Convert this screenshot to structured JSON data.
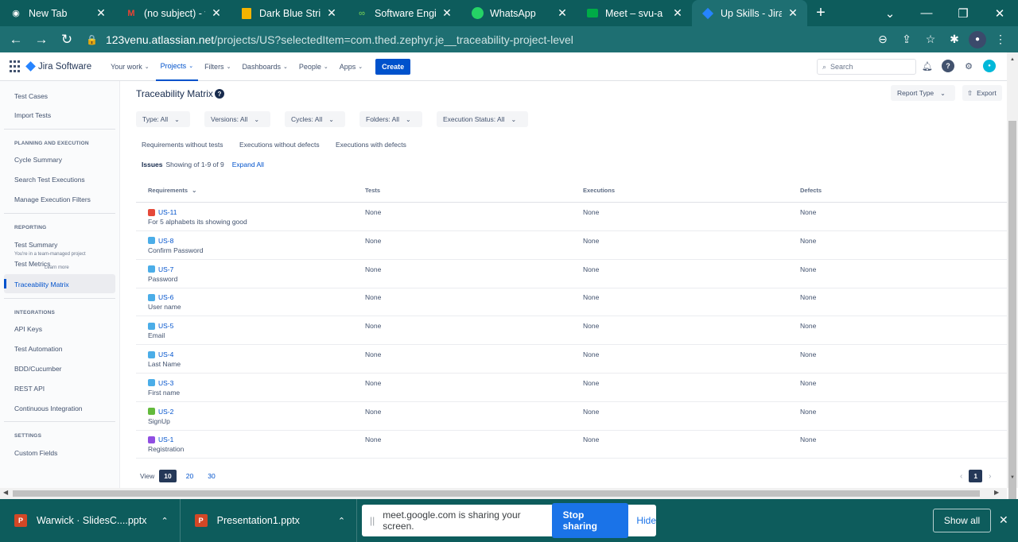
{
  "browser": {
    "tabs": [
      {
        "title": "New Tab",
        "icon": "chrome-icon"
      },
      {
        "title": "(no subject) - ven",
        "icon": "gmail-icon"
      },
      {
        "title": "Dark Blue Stripes",
        "icon": "slides-icon"
      },
      {
        "title": "Software Enginee",
        "icon": "link-icon"
      },
      {
        "title": "WhatsApp",
        "icon": "whatsapp-icon"
      },
      {
        "title": "Meet – svu-a",
        "icon": "meet-icon"
      },
      {
        "title": "Up Skills - Jira",
        "icon": "jira-icon"
      }
    ],
    "new_tab": "+",
    "url_host": "123venu.atlassian.net",
    "url_path": "/projects/US?selectedItem=com.thed.zephyr.je__traceability-project-level"
  },
  "jira": {
    "product": "Jira Software",
    "nav": [
      "Your work",
      "Projects",
      "Filters",
      "Dashboards",
      "People",
      "Apps"
    ],
    "create": "Create",
    "search_placeholder": "Search"
  },
  "sidebar": {
    "items_top": [
      "Test Cases",
      "Import Tests"
    ],
    "planning_head": "PLANNING AND EXECUTION",
    "planning": [
      "Cycle Summary",
      "Search Test Executions",
      "Manage Execution Filters"
    ],
    "reporting_head": "REPORTING",
    "reporting": [
      "Test Summary",
      "Test Metrics",
      "Traceability Matrix"
    ],
    "team_note": "You're in a team-managed project",
    "learn_more": "Learn more",
    "integrations_head": "INTEGRATIONS",
    "integrations": [
      "API Keys",
      "Test Automation",
      "BDD/Cucumber",
      "REST API",
      "Continuous Integration"
    ],
    "settings_head": "SETTINGS",
    "settings": [
      "Custom Fields"
    ]
  },
  "page": {
    "title": "Traceability Matrix",
    "report_type": "Report Type",
    "export": "Export",
    "filters": [
      "Type: All",
      "Versions: All",
      "Cycles: All",
      "Folders: All",
      "Execution Status: All"
    ],
    "quick_links": [
      "Requirements without tests",
      "Executions without defects",
      "Executions with defects"
    ],
    "issues_label": "Issues",
    "showing": "Showing of 1-9 of 9",
    "expand_all": "Expand All",
    "columns": [
      "Requirements",
      "Tests",
      "Executions",
      "Defects"
    ],
    "rows": [
      {
        "key": "US-11",
        "summary": "For 5 alphabets its showing good",
        "tests": "None",
        "executions": "None",
        "defects": "None",
        "type_color": "#e5493a"
      },
      {
        "key": "US-8",
        "summary": "Confirm Password",
        "tests": "None",
        "executions": "None",
        "defects": "None",
        "type_color": "#4bade8"
      },
      {
        "key": "US-7",
        "summary": "Password",
        "tests": "None",
        "executions": "None",
        "defects": "None",
        "type_color": "#4bade8"
      },
      {
        "key": "US-6",
        "summary": "User name",
        "tests": "None",
        "executions": "None",
        "defects": "None",
        "type_color": "#4bade8"
      },
      {
        "key": "US-5",
        "summary": "Email",
        "tests": "None",
        "executions": "None",
        "defects": "None",
        "type_color": "#4bade8"
      },
      {
        "key": "US-4",
        "summary": "Last Name",
        "tests": "None",
        "executions": "None",
        "defects": "None",
        "type_color": "#4bade8"
      },
      {
        "key": "US-3",
        "summary": "First name",
        "tests": "None",
        "executions": "None",
        "defects": "None",
        "type_color": "#4bade8"
      },
      {
        "key": "US-2",
        "summary": "SignUp",
        "tests": "None",
        "executions": "None",
        "defects": "None",
        "type_color": "#63ba3c"
      },
      {
        "key": "US-1",
        "summary": "Registration",
        "tests": "None",
        "executions": "None",
        "defects": "None",
        "type_color": "#904ee2"
      }
    ],
    "view_label": "View",
    "page_sizes": [
      "10",
      "20",
      "30"
    ],
    "current_page": "1"
  },
  "downloads": {
    "items": [
      "Warwick · SlidesC....pptx",
      "Presentation1.pptx"
    ],
    "share_text": "meet.google.com is sharing your screen.",
    "stop_sharing": "Stop sharing",
    "hide": "Hide",
    "show_all": "Show all"
  }
}
